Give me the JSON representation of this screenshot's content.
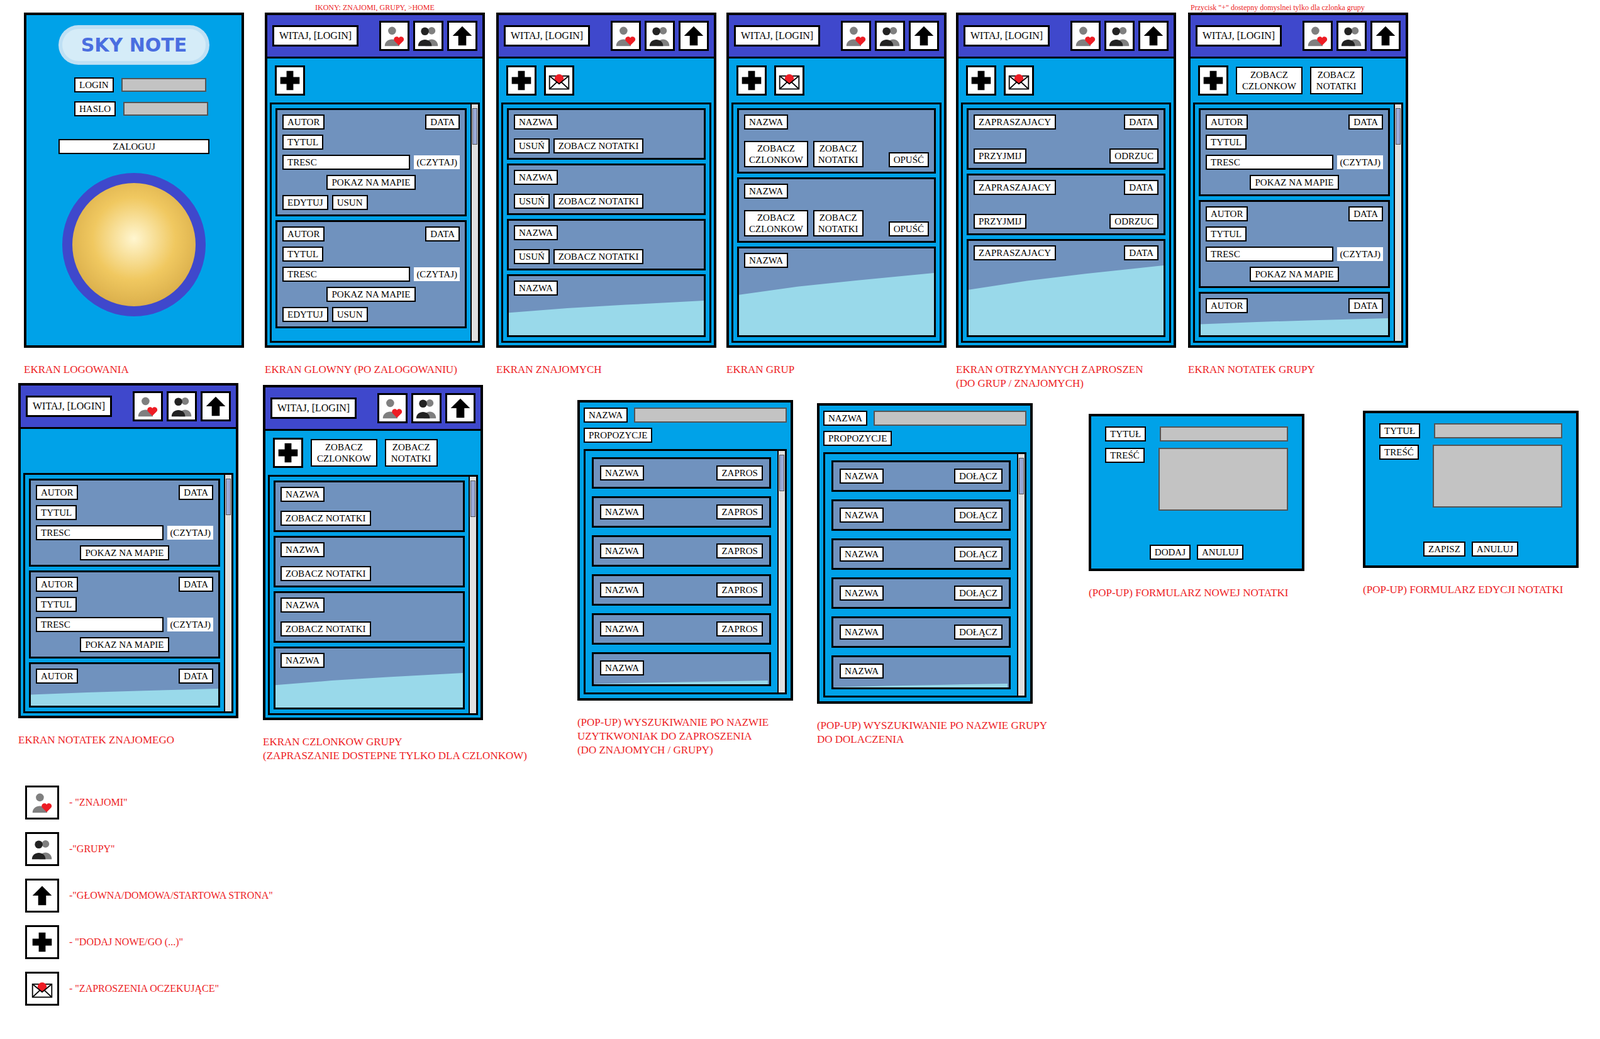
{
  "greeting": "WITAJ, [LOGIN]",
  "row1": [
    {
      "kind": "login",
      "annotation": "",
      "logo": "SKY NOTE",
      "fields": [
        {
          "label": "LOGIN",
          "value": ""
        },
        {
          "label": "HASLO",
          "value": ""
        }
      ],
      "button": "ZALOGUJ",
      "caption": [
        "EKRAN LOGOWANIA"
      ]
    },
    {
      "kind": "screen",
      "annotation": "IKONY: ZNAJOMI, GRUPY, >HOME",
      "toolbar": [
        {
          "kind": "plus"
        }
      ],
      "scrollbar": true,
      "items": [
        {
          "kind": "note",
          "cut": false,
          "author": "AUTOR",
          "date": "DATA",
          "title": "TYTUL",
          "content": "TRESC",
          "read": "(CZYTAJ)",
          "map": "POKAZ NA MAPIE",
          "actions": [
            "EDYTUJ",
            "USUN"
          ]
        },
        {
          "kind": "note",
          "cut": false,
          "author": "AUTOR",
          "date": "DATA",
          "title": "TYTUL",
          "content": "TRESC",
          "read": "(CZYTAJ)",
          "map": "POKAZ NA MAPIE",
          "actions": [
            "EDYTUJ",
            "USUN"
          ]
        }
      ],
      "caption": [
        "EKRAN GLOWNY (PO ZALOGOWANIU)"
      ]
    },
    {
      "kind": "screen",
      "annotation": "",
      "toolbar": [
        {
          "kind": "plus"
        },
        {
          "kind": "invites"
        }
      ],
      "scrollbar": false,
      "items": [
        {
          "kind": "friend",
          "cut": false,
          "name": "NAZWA",
          "actions": [
            "USUŃ",
            "ZOBACZ NOTATKI"
          ]
        },
        {
          "kind": "friend",
          "cut": false,
          "name": "NAZWA",
          "actions": [
            "USUŃ",
            "ZOBACZ NOTATKI"
          ]
        },
        {
          "kind": "friend",
          "cut": false,
          "name": "NAZWA",
          "actions": [
            "USUŃ",
            "ZOBACZ NOTATKI"
          ]
        },
        {
          "kind": "friend",
          "cut": true,
          "name": "NAZWA",
          "actions": []
        }
      ],
      "caption": [
        "EKRAN ZNAJOMYCH"
      ]
    },
    {
      "kind": "screen",
      "annotation": "",
      "toolbar": [
        {
          "kind": "plus"
        },
        {
          "kind": "invites"
        }
      ],
      "scrollbar": false,
      "items": [
        {
          "kind": "group",
          "cut": false,
          "name": "NAZWA",
          "actions": [
            "ZOBACZ CZLONKOW",
            "ZOBACZ NOTATKI"
          ],
          "leave": "OPUŚĆ"
        },
        {
          "kind": "group",
          "cut": false,
          "name": "NAZWA",
          "actions": [
            "ZOBACZ CZLONKOW",
            "ZOBACZ NOTATKI"
          ],
          "leave": "OPUŚĆ"
        },
        {
          "kind": "group",
          "cut": true,
          "name": "NAZWA",
          "actions": [],
          "leave": ""
        }
      ],
      "caption": [
        "EKRAN GRUP"
      ]
    },
    {
      "kind": "screen",
      "annotation": "",
      "toolbar": [
        {
          "kind": "plus"
        },
        {
          "kind": "invites"
        }
      ],
      "scrollbar": false,
      "items": [
        {
          "kind": "invite",
          "cut": false,
          "inviter": "ZAPRASZAJACY",
          "date": "DATA",
          "accept": "PRZYJMIJ",
          "reject": "ODRZUC"
        },
        {
          "kind": "invite",
          "cut": false,
          "inviter": "ZAPRASZAJACY",
          "date": "DATA",
          "accept": "PRZYJMIJ",
          "reject": "ODRZUC"
        },
        {
          "kind": "invite",
          "cut": true,
          "inviter": "ZAPRASZAJACY",
          "date": "DATA",
          "accept": "",
          "reject": ""
        }
      ],
      "caption": [
        "EKRAN OTRZYMANYCH ZAPROSZEN",
        "(DO GRUP / ZNAJOMYCH)"
      ]
    },
    {
      "kind": "screen",
      "annotation": "Przycisk \"+\" dostepny domyslnei tylko dla czlonka grupy",
      "toolbar": [
        {
          "kind": "plus"
        },
        {
          "kind": "text",
          "label": "ZOBACZ CZLONKOW"
        },
        {
          "kind": "text",
          "label": "ZOBACZ NOTATKI"
        }
      ],
      "scrollbar": true,
      "items": [
        {
          "kind": "note",
          "cut": false,
          "author": "AUTOR",
          "date": "DATA",
          "title": "TYTUL",
          "content": "TRESC",
          "read": "(CZYTAJ)",
          "map": "POKAZ NA MAPIE",
          "actions": []
        },
        {
          "kind": "note",
          "cut": false,
          "author": "AUTOR",
          "date": "DATA",
          "title": "TYTUL",
          "content": "TRESC",
          "read": "(CZYTAJ)",
          "map": "POKAZ NA MAPIE",
          "actions": []
        },
        {
          "kind": "note",
          "cut": true,
          "author": "AUTOR",
          "date": "DATA",
          "title": "",
          "content": "",
          "read": "",
          "map": "",
          "actions": []
        }
      ],
      "caption": [
        "EKRAN NOTATEK GRUPY"
      ]
    }
  ],
  "row2": [
    {
      "kind": "screen",
      "toolbar": [],
      "scrollbar": true,
      "items": [
        {
          "kind": "note",
          "cut": false,
          "author": "AUTOR",
          "date": "DATA",
          "title": "TYTUL",
          "content": "TRESC",
          "read": "(CZYTAJ)",
          "map": "POKAZ NA MAPIE",
          "actions": []
        },
        {
          "kind": "note",
          "cut": false,
          "author": "AUTOR",
          "date": "DATA",
          "title": "TYTUL",
          "content": "TRESC",
          "read": "(CZYTAJ)",
          "map": "POKAZ NA MAPIE",
          "actions": []
        },
        {
          "kind": "note",
          "cut": true,
          "author": "AUTOR",
          "date": "DATA",
          "title": "",
          "content": "",
          "read": "",
          "map": "",
          "actions": []
        }
      ],
      "caption": [
        "EKRAN NOTATEK  ZNAJOMEGO"
      ]
    },
    {
      "kind": "screen",
      "toolbar": [
        {
          "kind": "plus"
        },
        {
          "kind": "text",
          "label": "ZOBACZ CZLONKOW"
        },
        {
          "kind": "text",
          "label": "ZOBACZ NOTATKI"
        }
      ],
      "scrollbar": true,
      "items": [
        {
          "kind": "friend",
          "cut": false,
          "name": "NAZWA",
          "actions": [
            "ZOBACZ NOTATKI"
          ]
        },
        {
          "kind": "friend",
          "cut": false,
          "name": "NAZWA",
          "actions": [
            "ZOBACZ NOTATKI"
          ]
        },
        {
          "kind": "friend",
          "cut": false,
          "name": "NAZWA",
          "actions": [
            "ZOBACZ NOTATKI"
          ]
        },
        {
          "kind": "friend",
          "cut": true,
          "name": "NAZWA",
          "actions": []
        }
      ],
      "caption": [
        "EKRAN CZLONKOW GRUPY",
        "(ZAPRASZANIE DOSTEPNE TYLKO DLA CZLONKOW)"
      ]
    },
    {
      "kind": "search",
      "field": "NAZWA",
      "query": "",
      "suggest": "PROPOZYCJE",
      "scrollbar": true,
      "items": [
        {
          "kind": "result",
          "cut": false,
          "name": "NAZWA",
          "action": "ZAPROS"
        },
        {
          "kind": "result",
          "cut": false,
          "name": "NAZWA",
          "action": "ZAPROS"
        },
        {
          "kind": "result",
          "cut": false,
          "name": "NAZWA",
          "action": "ZAPROS"
        },
        {
          "kind": "result",
          "cut": false,
          "name": "NAZWA",
          "action": "ZAPROS"
        },
        {
          "kind": "result",
          "cut": false,
          "name": "NAZWA",
          "action": "ZAPROS"
        },
        {
          "kind": "result",
          "cut": true,
          "name": "NAZWA",
          "action": ""
        }
      ],
      "caption": [
        "(POP-UP) WYSZUKIWANIE PO NAZWIE",
        "UZYTKWONIAK DO ZAPROSZENIA",
        "(DO ZNAJOMYCH / GRUPY)"
      ]
    },
    {
      "kind": "search",
      "field": "NAZWA",
      "query": "",
      "suggest": "PROPOZYCJE",
      "scrollbar": true,
      "items": [
        {
          "kind": "result",
          "cut": false,
          "name": "NAZWA",
          "action": "DOŁĄCZ"
        },
        {
          "kind": "result",
          "cut": false,
          "name": "NAZWA",
          "action": "DOŁĄCZ"
        },
        {
          "kind": "result",
          "cut": false,
          "name": "NAZWA",
          "action": "DOŁĄCZ"
        },
        {
          "kind": "result",
          "cut": false,
          "name": "NAZWA",
          "action": "DOŁĄCZ"
        },
        {
          "kind": "result",
          "cut": false,
          "name": "NAZWA",
          "action": "DOŁĄCZ"
        },
        {
          "kind": "result",
          "cut": true,
          "name": "NAZWA",
          "action": ""
        }
      ],
      "caption": [
        "(POP-UP) WYSZUKIWANIE PO NAZWIE GRUPY",
        "DO DOLACZENIA"
      ]
    },
    {
      "kind": "form",
      "fields": [
        {
          "label": "TYTUŁ",
          "value": "",
          "multiline": false
        },
        {
          "label": "TREŚĆ",
          "value": "",
          "multiline": true
        }
      ],
      "buttons": [
        "DODAJ",
        "ANULUJ"
      ],
      "caption": [
        "(POP-UP) FORMULARZ NOWEJ NOTATKI"
      ]
    },
    {
      "kind": "form",
      "fields": [
        {
          "label": "TYTUŁ",
          "value": "",
          "multiline": false
        },
        {
          "label": "TREŚĆ",
          "value": "",
          "multiline": true
        }
      ],
      "buttons": [
        "ZAPISZ",
        "ANULUJ"
      ],
      "caption": [
        "(POP-UP) FORMULARZ EDYCJI NOTATKI"
      ]
    }
  ],
  "legend": [
    {
      "kind": "friends",
      "label": "- \"ZNAJOMI\""
    },
    {
      "kind": "groups",
      "label": "-\"GRUPY\""
    },
    {
      "kind": "home",
      "label": "-\"GŁOWNA/DOMOWA/STARTOWA STRONA\""
    },
    {
      "kind": "plus",
      "label": "- \"DODAJ NOWE/GO (...)\""
    },
    {
      "kind": "invites",
      "label": "- \"ZAPROSZENIA OCZEKUJĄCE\""
    }
  ]
}
